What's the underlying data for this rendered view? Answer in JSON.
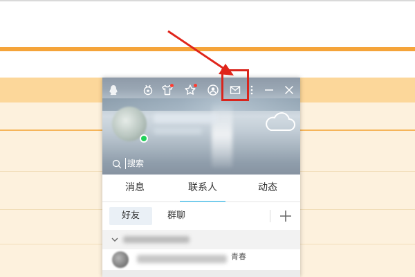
{
  "window_toolbar": {
    "icons": [
      "qq-penguin-icon",
      "medal-icon",
      "shirt-icon",
      "star-icon",
      "friend-icon",
      "mail-icon",
      "more-icon",
      "minimize-icon",
      "close-icon"
    ]
  },
  "profile": {
    "status": "online",
    "status_color": "#21d15a"
  },
  "search": {
    "placeholder": "搜索"
  },
  "tabs": {
    "items": [
      "消息",
      "联系人",
      "动态"
    ],
    "active": "联系人"
  },
  "subtabs": {
    "items": [
      "好友",
      "群聊"
    ],
    "active": "好友"
  },
  "contact": {
    "tail_text": "青春"
  },
  "colors": {
    "accent": "#12b7f5",
    "highlight": "#d9251d",
    "background_band": "#fcd79a",
    "background_line": "#f5a43a"
  }
}
